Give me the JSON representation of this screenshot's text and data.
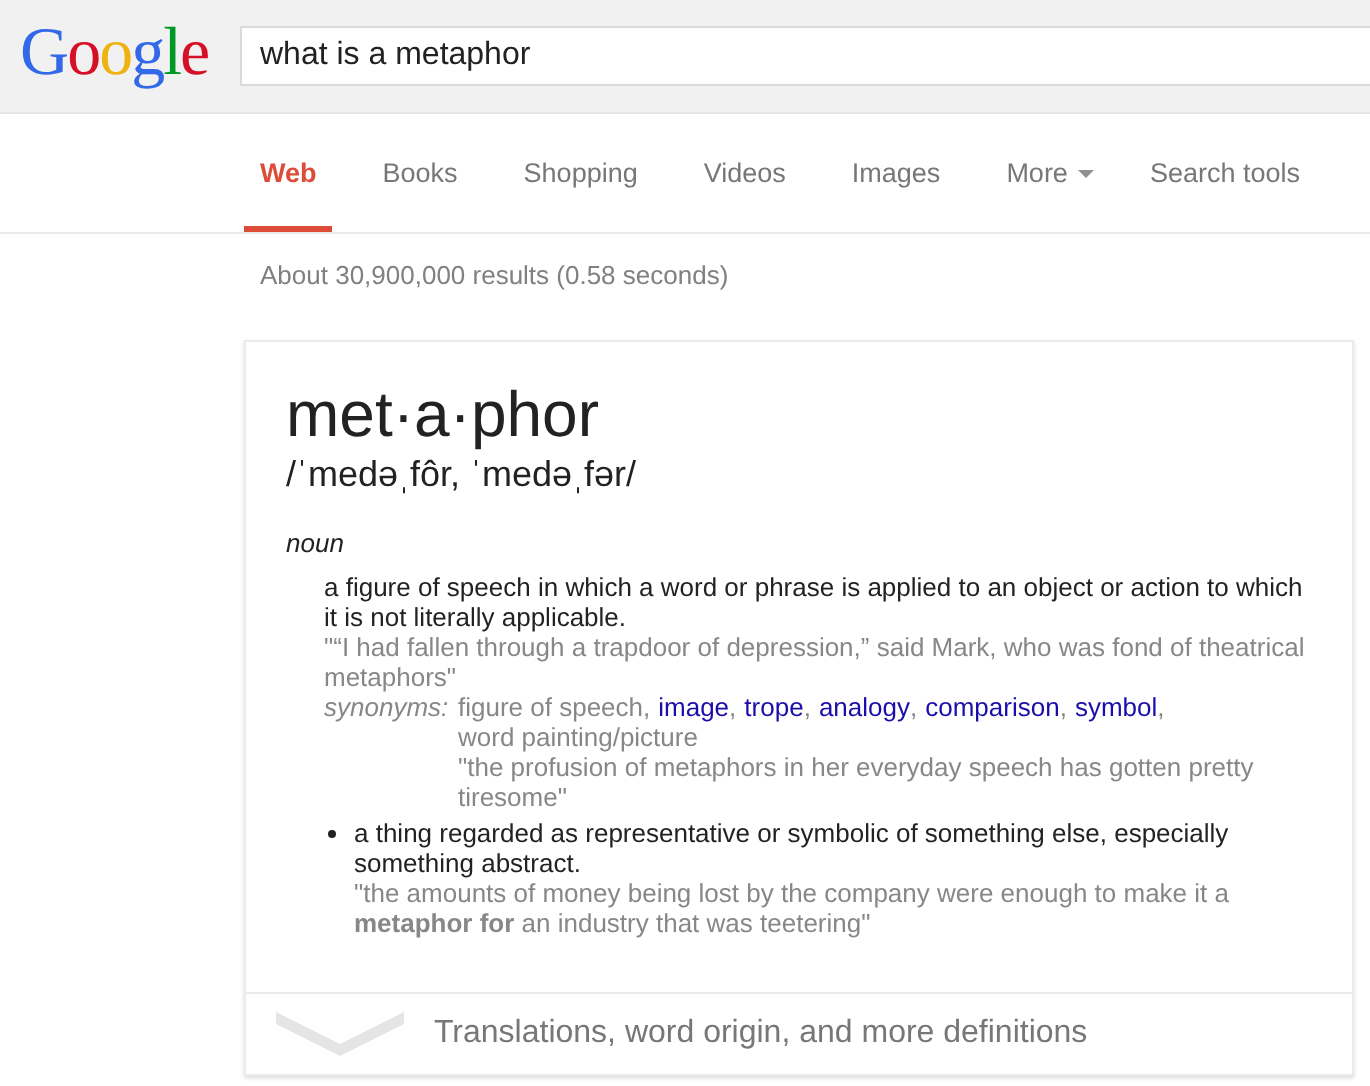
{
  "logo": [
    {
      "text": "G",
      "color": "#3369e8"
    },
    {
      "text": "o",
      "color": "#d50f25"
    },
    {
      "text": "o",
      "color": "#eeb211"
    },
    {
      "text": "g",
      "color": "#3369e8"
    },
    {
      "text": "l",
      "color": "#009925"
    },
    {
      "text": "e",
      "color": "#d50f25"
    }
  ],
  "search": {
    "value": "what is a metaphor"
  },
  "tabs": [
    {
      "label": "Web",
      "selected": true,
      "kind": "tab"
    },
    {
      "label": "Books",
      "selected": false,
      "kind": "tab"
    },
    {
      "label": "Shopping",
      "selected": false,
      "kind": "tab"
    },
    {
      "label": "Videos",
      "selected": false,
      "kind": "tab"
    },
    {
      "label": "Images",
      "selected": false,
      "kind": "tab"
    },
    {
      "label": "More",
      "selected": false,
      "kind": "dropdown"
    },
    {
      "label": "Search tools",
      "selected": false,
      "kind": "tool"
    }
  ],
  "result_stats": "About 30,900,000 results (0.58 seconds)",
  "definition_card": {
    "word": "met·a·phor",
    "pronunciation": "/ˈmedəˌfôr, ˈmedəˌfər/",
    "part_of_speech": "noun",
    "senses": [
      {
        "bulleted": false,
        "definition": "a figure of speech in which a word or phrase is applied to an object or action to which it is not literally applicable.",
        "example": "\"“I had fallen through a trapdoor of depression,” said Mark, who was fond of theatrical metaphors\"",
        "synonyms_label": "synonyms:",
        "synonyms": [
          {
            "text": "figure of speech",
            "link": false
          },
          {
            "text": "image",
            "link": true
          },
          {
            "text": "trope",
            "link": true
          },
          {
            "text": "analogy",
            "link": true
          },
          {
            "text": "comparison",
            "link": true
          },
          {
            "text": "symbol",
            "link": true
          },
          {
            "text": "word painting/picture",
            "link": false
          }
        ],
        "synonyms_separator": ",",
        "synonym_example": "\"the profusion of metaphors in her everyday speech has gotten pretty tiresome\""
      },
      {
        "bulleted": true,
        "definition": "a thing regarded as representative or symbolic of something else, especially something abstract.",
        "example": "\"the amounts of money being lost by the company were enough to make it a **metaphor for** an industry that was teetering\""
      }
    ],
    "more_link": "Translations, word origin, and more definitions"
  }
}
